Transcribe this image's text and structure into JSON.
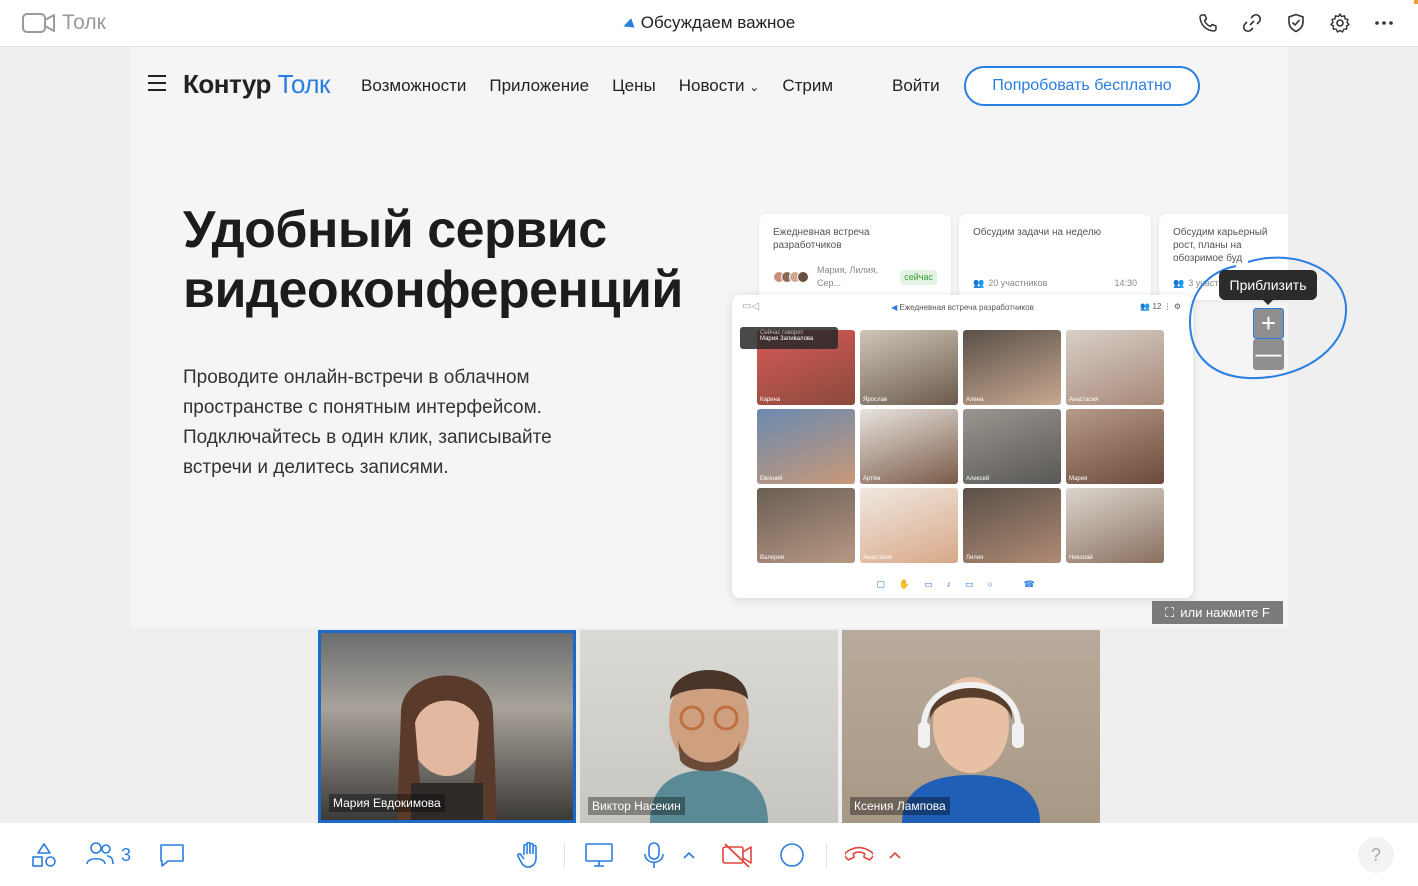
{
  "app": {
    "name": "Толк"
  },
  "meeting": {
    "title": "Обсуждаем важное"
  },
  "top_actions": [
    "phone-icon",
    "link-icon",
    "shield-icon",
    "gear-icon",
    "more-icon"
  ],
  "site": {
    "logo_dark": "Контур",
    "logo_blue": "Толк",
    "nav": {
      "features": "Возможности",
      "app": "Приложение",
      "prices": "Цены",
      "news": "Новости",
      "stream": "Стрим"
    },
    "login": "Войти",
    "try_button": "Попробовать бесплатно",
    "hero_line1": "Удобный сервис",
    "hero_line2": "видеоконференций",
    "hero_text": "Проводите онлайн-встречи в облачном пространстве с понятным интерфейсом. Подключайтесь в один клик, записывайте встречи и делитесь записями."
  },
  "preview": {
    "cards": [
      {
        "title": "Ежедневная встреча разработчиков",
        "people": "Мария, Лилия, Сер...",
        "badge": "сейчас"
      },
      {
        "title": "Обсудим задачи на неделю",
        "people": "20 участников",
        "time": "14:30"
      },
      {
        "title": "Обсудим карьерный рост, планы на обозримое буд",
        "people": "3 участн"
      }
    ],
    "window_title": "Ежедневная встреча разработчиков",
    "window_count": "12",
    "speaking_label": "Сейчас говорит",
    "speaking_name": "Мария Запивалова",
    "tiles": [
      "Карина",
      "Ярослав",
      "Алена",
      "Анастасия",
      "Евгений",
      "Артём",
      "Алексей",
      "Мария",
      "Валерия",
      "Анастасия",
      "Лилия",
      "Николай"
    ]
  },
  "zoom": {
    "tooltip": "Приблизить",
    "plus": "+",
    "minus": "—",
    "hint": "или нажмите F"
  },
  "participants": [
    {
      "name": "Мария Евдокимова",
      "active": true
    },
    {
      "name": "Виктор Насекин",
      "active": false
    },
    {
      "name": "Ксения Лампова",
      "active": false
    }
  ],
  "bottombar": {
    "participants_count": "3",
    "help": "?"
  },
  "colors": {
    "accent": "#2a7de1",
    "danger": "#e0463c",
    "active_border": "#1d69c9"
  }
}
